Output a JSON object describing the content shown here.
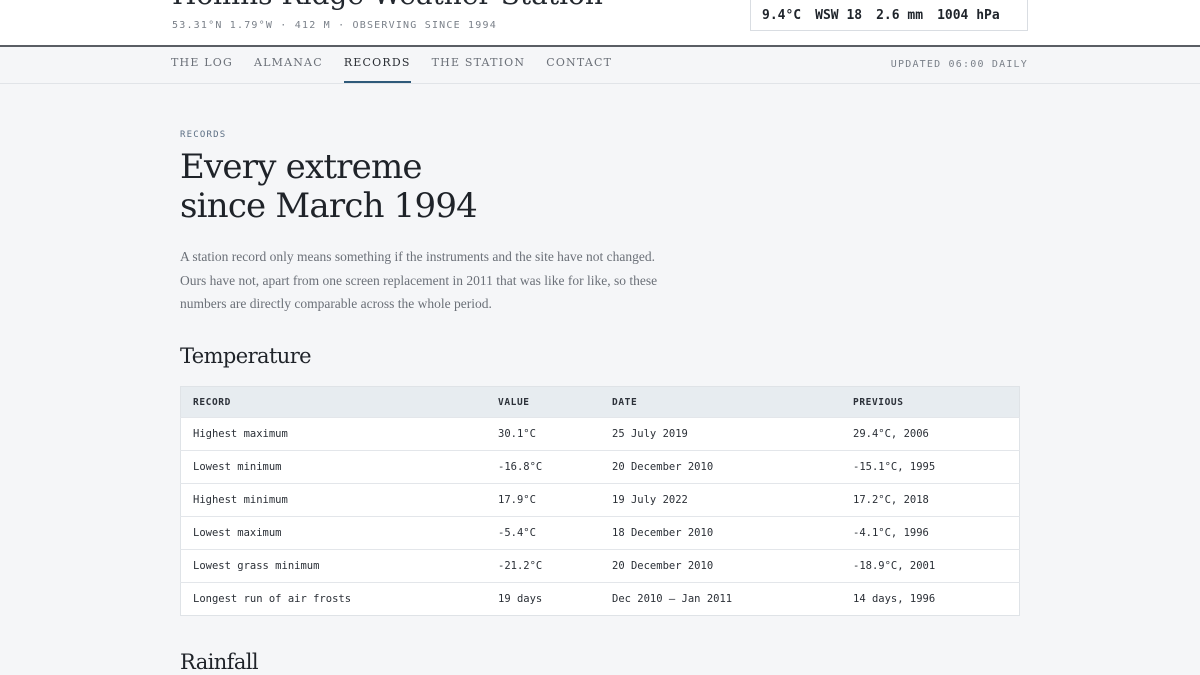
{
  "header": {
    "site_title": "Hollins Ridge Weather Station",
    "site_meta": "53.31°N 1.79°W · 412 M · OBSERVING SINCE 1994",
    "readout": {
      "temperature": "9.4°C",
      "wind": "WSW 18",
      "rain": "2.6 mm",
      "pressure": "1004 hPa"
    }
  },
  "nav": {
    "items": [
      {
        "label": "THE LOG"
      },
      {
        "label": "ALMANAC"
      },
      {
        "label": "RECORDS"
      },
      {
        "label": "THE STATION"
      },
      {
        "label": "CONTACT"
      }
    ],
    "active": "RECORDS",
    "updated": "UPDATED 06:00 DAILY"
  },
  "main": {
    "eyebrow": "RECORDS",
    "headline_line1": "Every extreme",
    "headline_line2": "since March 1994",
    "intro": "A station record only means something if the instruments and the site have not changed. Ours have not, apart from one screen replacement in 2011 that was like for like, so these numbers are directly comparable across the whole period.",
    "temperature": {
      "heading": "Temperature",
      "columns": [
        "RECORD",
        "VALUE",
        "DATE",
        "PREVIOUS"
      ],
      "rows": [
        {
          "record": "Highest maximum",
          "value": "30.1°C",
          "date": "25 July 2019",
          "previous": "29.4°C, 2006"
        },
        {
          "record": "Lowest minimum",
          "value": "-16.8°C",
          "date": "20 December 2010",
          "previous": "-15.1°C, 1995"
        },
        {
          "record": "Highest minimum",
          "value": "17.9°C",
          "date": "19 July 2022",
          "previous": "17.2°C, 2018"
        },
        {
          "record": "Lowest maximum",
          "value": "-5.4°C",
          "date": "18 December 2010",
          "previous": "-4.1°C, 1996"
        },
        {
          "record": "Lowest grass minimum",
          "value": "-21.2°C",
          "date": "20 December 2010",
          "previous": "-18.9°C, 2001"
        },
        {
          "record": "Longest run of air frosts",
          "value": "19 days",
          "date": "Dec 2010 – Jan 2011",
          "previous": "14 days, 1996"
        }
      ]
    },
    "rainfall": {
      "heading": "Rainfall"
    }
  }
}
